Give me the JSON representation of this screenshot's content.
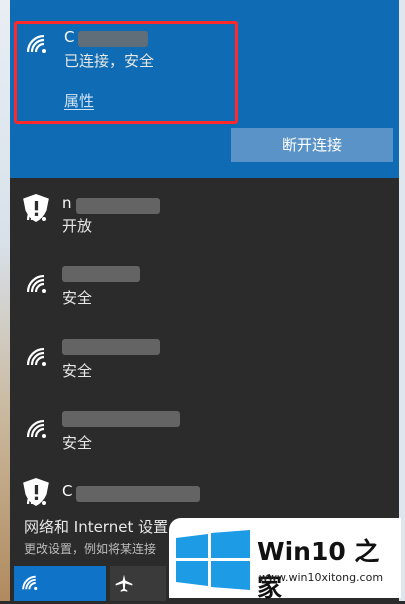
{
  "active": {
    "status": "已连接，安全",
    "properties": "属性",
    "disconnect": "断开连接"
  },
  "networks": [
    {
      "status": "开放",
      "secured_icon": true
    },
    {
      "status": "安全",
      "secured_icon": false
    },
    {
      "status": "安全",
      "secured_icon": false
    },
    {
      "status": "安全",
      "secured_icon": false
    }
  ],
  "footer": {
    "title": "网络和 Internet 设置",
    "subtitle": "更改设置，例如将某连接"
  },
  "watermark": {
    "title": "Win10 之家",
    "url": "www.win10xitong.com"
  },
  "colors": {
    "accent": "#0f6bb3",
    "highlight": "#ff2929"
  },
  "icons": [
    "wifi-icon",
    "shield-icon",
    "airplane-icon",
    "windows-logo-icon"
  ]
}
